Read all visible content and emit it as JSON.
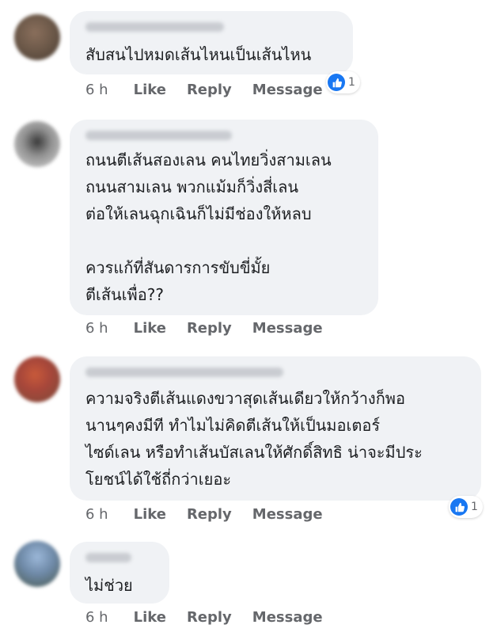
{
  "comments": [
    {
      "text": "สับสนไปหมดเส้นไหนเป็นเส้นไหน",
      "time": "6 h",
      "like": "Like",
      "reply": "Reply",
      "message": "Message",
      "reactions": "1"
    },
    {
      "text": "ถนนตีเส้นสองเลน คนไทยวิ่งสามเลน\nถนนสามเลน พวกแม้มก็วิ่งสี่เลน\nต่อให้เลนฉุกเฉินก็ไม่มีช่องให้หลบ\n\nควรแก้ที่สันดารการขับขี่มั้ย\nตีเส้นเพื่อ??",
      "time": "6 h",
      "like": "Like",
      "reply": "Reply",
      "message": "Message"
    },
    {
      "text": "ความจริงตีเส้นแดงขวาสุดเส้นเดียวให้กว้างก็พอ\nนานๆคงมีที ทำไมไม่คิดตีเส้นให้เป็นมอเตอร์\nไซด์เลน หรือทำเส้นบัสเลนให้ศักดิ์สิทธิ น่าจะมีประ\nโยชน์ได้ใช้ถี่กว่าเยอะ",
      "time": "6 h",
      "like": "Like",
      "reply": "Reply",
      "message": "Message",
      "reactions": "1"
    },
    {
      "text": "ไม่ช่วย",
      "time": "6 h",
      "like": "Like",
      "reply": "Reply",
      "message": "Message"
    }
  ],
  "colors": {
    "bubble": "#f0f2f5",
    "text": "#1c1e21",
    "meta": "#65676b",
    "like_blue": "#1877f2"
  },
  "icons": {
    "reaction": "thumbs-up-icon"
  }
}
